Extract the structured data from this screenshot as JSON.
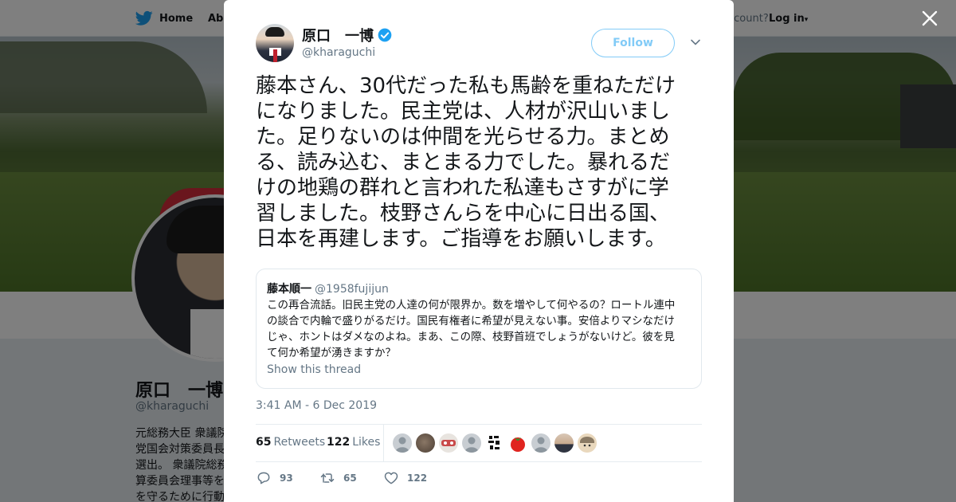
{
  "nav": {
    "home_label": "Home",
    "about_label": "Abo",
    "account_text": "ccount?",
    "login_label": "Log in"
  },
  "profile": {
    "name": "原口　一博",
    "handle": "@kharaguchi",
    "bio_lines": [
      "元総務大臣 衆議院",
      "党国会対策委員長",
      "選出。 衆議院総務",
      "算委員会理事等を",
      "を守るために行動"
    ]
  },
  "tweet": {
    "author_name": "原口　一博",
    "author_handle": "@kharaguchi",
    "follow_label": "Follow",
    "text_lines": [
      "藤本さん、30代だった私も馬齢を重ねただけ",
      "になりました。民主党は、人材が沢山いまし",
      "た。足りないのは仲間を光らせる力。まとめ",
      "る、読み込む、まとまる力でした。暴れるだ",
      "けの地鶏の群れと言われた私達もさすがに学",
      "習しました。枝野さんらを中心に日出る国、",
      "日本を再建します。ご指導をお願いします。"
    ],
    "quote": {
      "name": "藤本順一",
      "handle": "@1958fujijun",
      "text_lines": [
        "この再合流話。旧民主党の人達の何が限界か。数を増やして何やるの？ロートル連中",
        "の談合で内輪で盛りがるだけ。国民有権者に希望が見えない事。安倍よりマシなだけ",
        "じゃ、ホントはダメなのよね。まあ、この際、枝野首班でしょうがないけど。彼を見",
        "て何か希望が湧きますか？"
      ],
      "show_thread_label": "Show this thread"
    },
    "timestamp": "3:41 AM - 6 Dec 2019",
    "retweets_count": "65",
    "retweets_label": "Retweets",
    "likes_count": "122",
    "likes_label": "Likes",
    "reply_count": "93",
    "retweet_action_count": "65",
    "like_action_count": "122"
  },
  "colors": {
    "twitter_blue": "#1da1f2",
    "text_primary": "#14171a",
    "text_secondary": "#657786",
    "overlay": "rgba(0,0,0,0.5)"
  },
  "icons": [
    "twitter-bird-icon",
    "verified-icon",
    "chevron-down-icon",
    "close-icon",
    "reply-icon",
    "retweet-icon",
    "like-icon"
  ]
}
